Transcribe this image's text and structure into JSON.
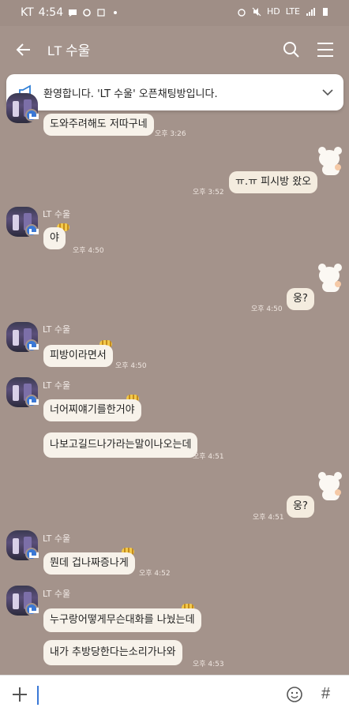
{
  "status_bar": {
    "carrier": "KT",
    "time": "4:54",
    "network": "LTE",
    "hd": "HD"
  },
  "header": {
    "title": "LT 수울"
  },
  "notice": {
    "text": "환영합니다. 'LT 수울' 오픈채팅방입니다."
  },
  "messages": [
    {
      "type": "in",
      "text": "도와주려해도 저따구네",
      "time": "오후 3:26"
    },
    {
      "type": "out",
      "text": "ㅠ.ㅠ 피시방 왔오",
      "time": "오후 3:52"
    },
    {
      "type": "in",
      "sender": "LT 수울",
      "text": "야",
      "time": "오후 4:50"
    },
    {
      "type": "out",
      "text": "웅?",
      "time": "오후 4:50"
    },
    {
      "type": "in",
      "sender": "LT 수울",
      "text": "피방이라면서",
      "time": "오후 4:50"
    },
    {
      "type": "in",
      "sender": "LT 수울",
      "text": "너어찌얘기를한거야",
      "time": ""
    },
    {
      "type": "in",
      "text": "나보고길드나가라는말이나오는데",
      "time": "오후 4:51"
    },
    {
      "type": "out",
      "text": "웅?",
      "time": "오후 4:51"
    },
    {
      "type": "in",
      "sender": "LT 수울",
      "text": "뭔데 겁나짜증나게",
      "time": "오후 4:52"
    },
    {
      "type": "in",
      "sender": "LT 수울",
      "text": "누구랑어떻게무슨대화를 나눴는데",
      "time": ""
    },
    {
      "type": "in",
      "text": "내가 추방당한다는소리가나와",
      "time": "오후 4:53"
    }
  ],
  "input": {
    "hash": "#"
  },
  "colors": {
    "background": "#a4938b",
    "bubble": "#f7f2ea",
    "accent": "#3a78d6"
  }
}
